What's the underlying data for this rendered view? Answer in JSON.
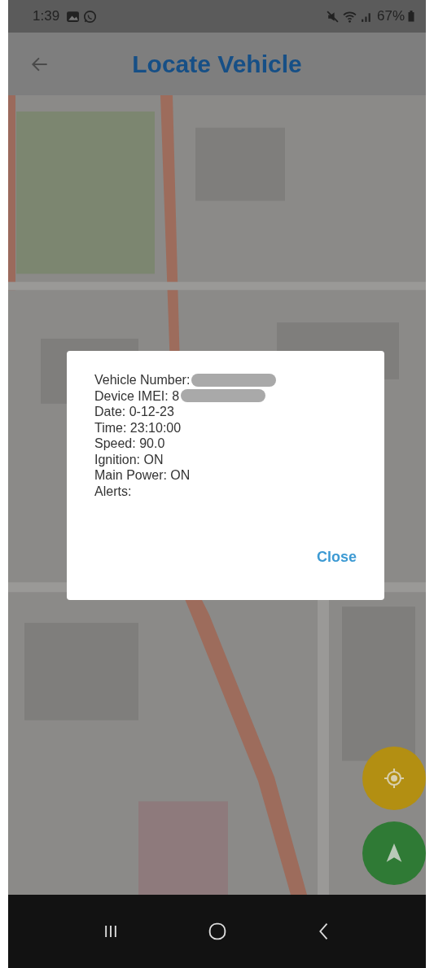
{
  "status_bar": {
    "time": "1:39",
    "battery": "67%"
  },
  "app_bar": {
    "title": "Locate Vehicle"
  },
  "dialog": {
    "lines": [
      {
        "text": "Vehicle Number:",
        "redacted": true
      },
      {
        "text": "Device IMEI: 8",
        "redacted": true
      },
      {
        "text": "Date: 0-12-23",
        "redacted": false
      },
      {
        "text": "Time: 23:10:00",
        "redacted": false
      },
      {
        "text": "Speed: 90.0",
        "redacted": false
      },
      {
        "text": "Ignition: ON",
        "redacted": false
      },
      {
        "text": "Main Power: ON",
        "redacted": false
      },
      {
        "text": "Alerts:",
        "redacted": false
      }
    ],
    "button": "Close"
  },
  "fabs": [
    {
      "kind": "locate"
    },
    {
      "kind": "navigate"
    }
  ]
}
